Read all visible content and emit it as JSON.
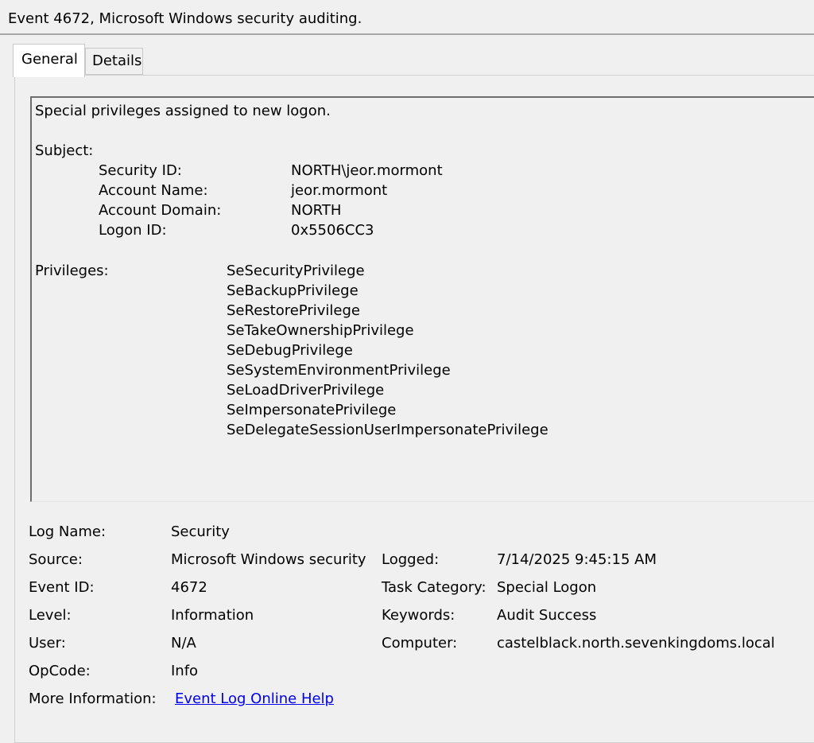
{
  "window": {
    "title": "Event 4672, Microsoft Windows security auditing."
  },
  "tabs": [
    {
      "label": "General",
      "selected": true
    },
    {
      "label": "Details",
      "selected": false
    }
  ],
  "description": {
    "headline": "Special privileges assigned to new logon.",
    "subject_label": "Subject:",
    "subject_fields": [
      {
        "label": "Security ID:",
        "value": "NORTH\\jeor.mormont"
      },
      {
        "label": "Account Name:",
        "value": "jeor.mormont"
      },
      {
        "label": "Account Domain:",
        "value": "NORTH"
      },
      {
        "label": "Logon ID:",
        "value": "0x5506CC3"
      }
    ],
    "privileges_label": "Privileges:",
    "privileges": [
      "SeSecurityPrivilege",
      "SeBackupPrivilege",
      "SeRestorePrivilege",
      "SeTakeOwnershipPrivilege",
      "SeDebugPrivilege",
      "SeSystemEnvironmentPrivilege",
      "SeLoadDriverPrivilege",
      "SeImpersonatePrivilege",
      "SeDelegateSessionUserImpersonatePrivilege"
    ]
  },
  "details": {
    "log_name": {
      "label": "Log Name:",
      "value": "Security"
    },
    "source": {
      "label": "Source:",
      "value": "Microsoft Windows security"
    },
    "logged": {
      "label": "Logged:",
      "value": "7/14/2025 9:45:15 AM"
    },
    "event_id": {
      "label": "Event ID:",
      "value": "4672"
    },
    "task_category": {
      "label": "Task Category:",
      "value": "Special Logon"
    },
    "level": {
      "label": "Level:",
      "value": "Information"
    },
    "keywords": {
      "label": "Keywords:",
      "value": "Audit Success"
    },
    "user": {
      "label": "User:",
      "value": "N/A"
    },
    "computer": {
      "label": "Computer:",
      "value": "castelblack.north.sevenkingdoms.local"
    },
    "opcode": {
      "label": "OpCode:",
      "value": "Info"
    },
    "more_info": {
      "label": "More Information:",
      "link": "Event Log Online Help"
    }
  },
  "colors": {
    "link": "#0000ee",
    "background": "#f0f0f0",
    "tab_selected": "#ffffff"
  }
}
